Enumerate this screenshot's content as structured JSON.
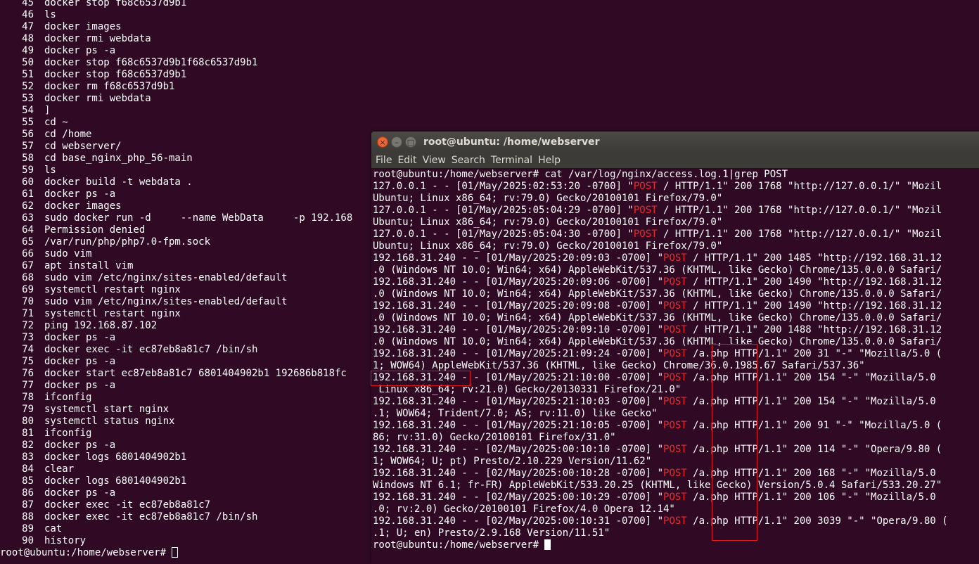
{
  "background_terminal": {
    "history": [
      {
        "n": "45",
        "cmd": "docker stop f68c6537d9b1"
      },
      {
        "n": "46",
        "cmd": "ls"
      },
      {
        "n": "47",
        "cmd": "docker images"
      },
      {
        "n": "48",
        "cmd": "docker rmi webdata"
      },
      {
        "n": "49",
        "cmd": "docker ps -a"
      },
      {
        "n": "50",
        "cmd": "docker stop f68c6537d9b1f68c6537d9b1"
      },
      {
        "n": "51",
        "cmd": "docker stop f68c6537d9b1"
      },
      {
        "n": "52",
        "cmd": "docker rm f68c6537d9b1"
      },
      {
        "n": "53",
        "cmd": "docker rmi webdata"
      },
      {
        "n": "54",
        "cmd": "]"
      },
      {
        "n": "55",
        "cmd": "cd ~"
      },
      {
        "n": "56",
        "cmd": "cd /home"
      },
      {
        "n": "57",
        "cmd": "cd webserver/"
      },
      {
        "n": "58",
        "cmd": "cd base_nginx_php_56-main"
      },
      {
        "n": "59",
        "cmd": "ls"
      },
      {
        "n": "60",
        "cmd": "docker build -t webdata ."
      },
      {
        "n": "61",
        "cmd": "docker ps -a"
      },
      {
        "n": "62",
        "cmd": "docker images"
      },
      {
        "n": "63",
        "cmd": "sudo docker run -d     --name WebData     -p 192.168"
      },
      {
        "n": "64",
        "cmd": "Permission denied"
      },
      {
        "n": "65",
        "cmd": "/var/run/php/php7.0-fpm.sock"
      },
      {
        "n": "66",
        "cmd": "sudo vim"
      },
      {
        "n": "67",
        "cmd": "apt install vim"
      },
      {
        "n": "68",
        "cmd": "sudo vim /etc/nginx/sites-enabled/default"
      },
      {
        "n": "69",
        "cmd": "systemctl restart nginx"
      },
      {
        "n": "70",
        "cmd": "sudo vim /etc/nginx/sites-enabled/default"
      },
      {
        "n": "71",
        "cmd": "systemctl restart nginx"
      },
      {
        "n": "72",
        "cmd": "ping 192.168.87.102"
      },
      {
        "n": "73",
        "cmd": "docker ps -a"
      },
      {
        "n": "74",
        "cmd": "docker exec -it ec87eb8a81c7 /bin/sh"
      },
      {
        "n": "75",
        "cmd": "docker ps -a"
      },
      {
        "n": "76",
        "cmd": "docker start ec87eb8a81c7 6801404902b1 192686b818fc"
      },
      {
        "n": "77",
        "cmd": "docker ps -a"
      },
      {
        "n": "78",
        "cmd": "ifconfig"
      },
      {
        "n": "79",
        "cmd": "systemctl start nginx"
      },
      {
        "n": "80",
        "cmd": "systemctl status nginx"
      },
      {
        "n": "81",
        "cmd": "ifconfig"
      },
      {
        "n": "82",
        "cmd": "docker ps -a"
      },
      {
        "n": "83",
        "cmd": "docker logs 6801404902b1"
      },
      {
        "n": "84",
        "cmd": "clear"
      },
      {
        "n": "85",
        "cmd": "docker logs 6801404902b1"
      },
      {
        "n": "86",
        "cmd": "docker ps -a"
      },
      {
        "n": "87",
        "cmd": "docker exec -it ec87eb8a81c7"
      },
      {
        "n": "88",
        "cmd": "docker exec -it ec87eb8a81c7 /bin/sh"
      },
      {
        "n": "89",
        "cmd": "cat"
      },
      {
        "n": "90",
        "cmd": "history"
      }
    ],
    "prompt": "root@ubuntu:/home/webserver# "
  },
  "window": {
    "title": "root@ubuntu: /home/webserver",
    "close_glyph": "×",
    "min_glyph": "–",
    "max_glyph": "□",
    "menu": [
      "File",
      "Edit",
      "View",
      "Search",
      "Terminal",
      "Help"
    ],
    "command_line": "root@ubuntu:/home/webserver# cat /var/log/nginx/access.log.1|grep POST",
    "log_lines": [
      {
        "pre": "127.0.0.1 - - [01/May/2025:02:53:20 -0700] \"",
        "post": " / HTTP/1.1\" 200 1768 \"http://127.0.0.1/\" \"Mozil"
      },
      {
        "text": "Ubuntu; Linux x86_64; rv:79.0) Gecko/20100101 Firefox/79.0\""
      },
      {
        "pre": "127.0.0.1 - - [01/May/2025:05:04:29 -0700] \"",
        "post": " / HTTP/1.1\" 200 1768 \"http://127.0.0.1/\" \"Mozil"
      },
      {
        "text": "Ubuntu; Linux x86_64; rv:79.0) Gecko/20100101 Firefox/79.0\""
      },
      {
        "pre": "127.0.0.1 - - [01/May/2025:05:04:30 -0700] \"",
        "post": " / HTTP/1.1\" 200 1768 \"http://127.0.0.1/\" \"Mozil"
      },
      {
        "text": "Ubuntu; Linux x86_64; rv:79.0) Gecko/20100101 Firefox/79.0\""
      },
      {
        "pre": "192.168.31.240 - - [01/May/2025:20:09:03 -0700] \"",
        "post": " / HTTP/1.1\" 200 1485 \"http://192.168.31.12"
      },
      {
        "text": ".0 (Windows NT 10.0; Win64; x64) AppleWebKit/537.36 (KHTML, like Gecko) Chrome/135.0.0.0 Safari/"
      },
      {
        "pre": "192.168.31.240 - - [01/May/2025:20:09:06 -0700] \"",
        "post": " / HTTP/1.1\" 200 1490 \"http://192.168.31.12"
      },
      {
        "text": ".0 (Windows NT 10.0; Win64; x64) AppleWebKit/537.36 (KHTML, like Gecko) Chrome/135.0.0.0 Safari/"
      },
      {
        "pre": "192.168.31.240 - - [01/May/2025:20:09:08 -0700] \"",
        "post": " / HTTP/1.1\" 200 1490 \"http://192.168.31.12"
      },
      {
        "text": ".0 (Windows NT 10.0; Win64; x64) AppleWebKit/537.36 (KHTML, like Gecko) Chrome/135.0.0.0 Safari/"
      },
      {
        "pre": "192.168.31.240 - - [01/May/2025:20:09:10 -0700] \"",
        "post": " / HTTP/1.1\" 200 1488 \"http://192.168.31.12"
      },
      {
        "text": ".0 (Windows NT 10.0; Win64; x64) AppleWebKit/537.36 (KHTML, like Gecko) Chrome/135.0.0.0 Safari/"
      },
      {
        "pre": "192.168.31.240 - - [01/May/2025:21:09:24 -0700] \"",
        "post": " /a.php HTTP/1.1\" 200 31 \"-\" \"Mozilla/5.0 ("
      },
      {
        "text": "1; WOW64) AppleWebKit/537.36 (KHTML, like Gecko) Chrome/36.0.1985.67 Safari/537.36\""
      },
      {
        "pre": "192.168.31.240 - - [01/May/2025:21:10:00 -0700] \"",
        "post": " /a.php HTTP/1.1\" 200 154 \"-\" \"Mozilla/5.0"
      },
      {
        "text": " Linux x86_64; rv:21.0) Gecko/20130331 Firefox/21.0\""
      },
      {
        "pre": "192.168.31.240 - - [01/May/2025:21:10:03 -0700] \"",
        "post": " /a.php HTTP/1.1\" 200 154 \"-\" \"Mozilla/5.0"
      },
      {
        "text": ".1; WOW64; Trident/7.0; AS; rv:11.0) like Gecko\""
      },
      {
        "pre": "192.168.31.240 - - [01/May/2025:21:10:05 -0700] \"",
        "post": " /a.php HTTP/1.1\" 200 91 \"-\" \"Mozilla/5.0 ("
      },
      {
        "text": "86; rv:31.0) Gecko/20100101 Firefox/31.0\""
      },
      {
        "pre": "192.168.31.240 - - [02/May/2025:00:10:10 -0700] \"",
        "post": " /a.php HTTP/1.1\" 200 114 \"-\" \"Opera/9.80 ("
      },
      {
        "text": "1; WOW64; U; pt) Presto/2.10.229 Version/11.62\""
      },
      {
        "pre": "192.168.31.240 - - [02/May/2025:00:10:28 -0700] \"",
        "post": " /a.php HTTP/1.1\" 200 168 \"-\" \"Mozilla/5.0"
      },
      {
        "text": "Windows NT 6.1; fr-FR) AppleWebKit/533.20.25 (KHTML, like Gecko) Version/5.0.4 Safari/533.20.27\""
      },
      {
        "pre": "192.168.31.240 - - [02/May/2025:00:10:29 -0700] \"",
        "post": " /a.php HTTP/1.1\" 200 106 \"-\" \"Mozilla/5.0"
      },
      {
        "text": ".0; rv:2.0) Gecko/20100101 Firefox/4.0 Opera 12.14\""
      },
      {
        "pre": "192.168.31.240 - - [02/May/2025:00:10:31 -0700] \"",
        "post": " /a.php HTTP/1.1\" 200 3039 \"-\" \"Opera/9.80 ("
      },
      {
        "text": ".1; U; en) Presto/2.9.168 Version/11.51\""
      }
    ],
    "post_keyword": "POST",
    "final_prompt": "root@ubuntu:/home/webserver# "
  },
  "colors": {
    "terminal_bg": "#300a24",
    "post_highlight": "#ef2929",
    "annotation_box": "#e01b24",
    "titlebar": "#3c3b37"
  }
}
